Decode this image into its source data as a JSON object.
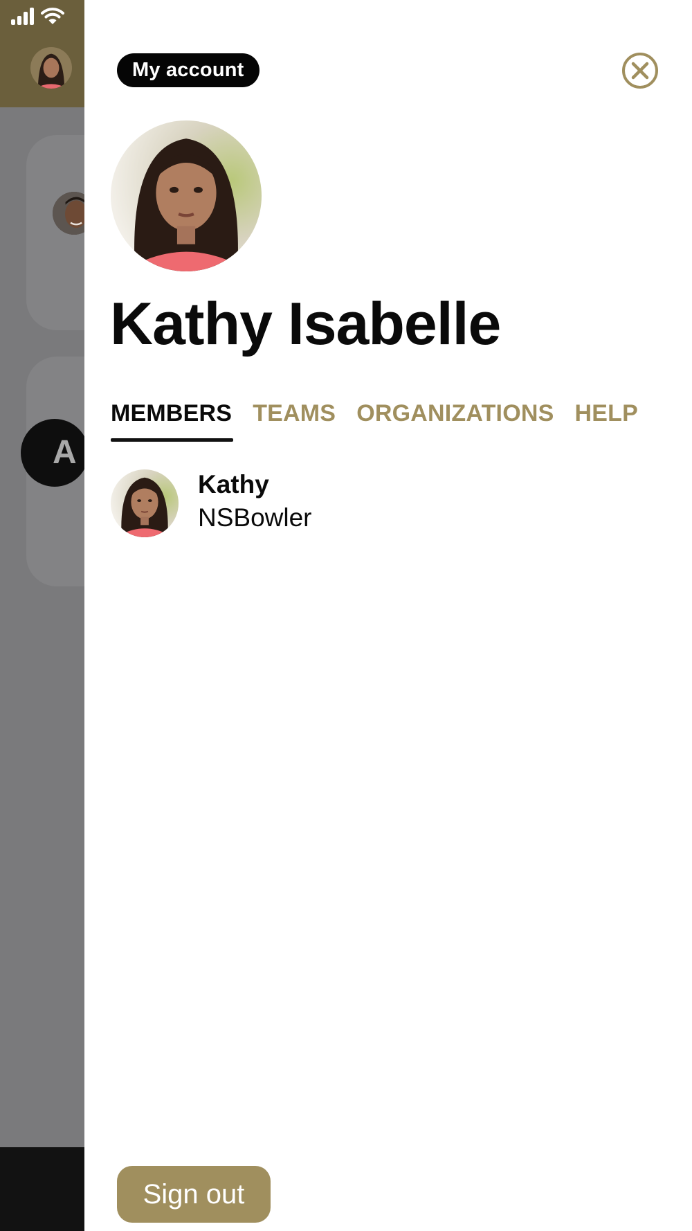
{
  "header": {
    "account_label": "My account"
  },
  "profile": {
    "name": "Kathy Isabelle"
  },
  "tabs": [
    {
      "label": "MEMBERS",
      "active": true
    },
    {
      "label": "TEAMS",
      "active": false
    },
    {
      "label": "ORGANIZATIONS",
      "active": false
    },
    {
      "label": "HELP",
      "active": false
    }
  ],
  "members": [
    {
      "name": "Kathy",
      "username": "NSBowler"
    }
  ],
  "footer": {
    "sign_out_label": "Sign out"
  },
  "background": {
    "avatar_letter": "A"
  },
  "icons": {
    "close": "close-circle-icon",
    "signal": "cellular-signal-icon",
    "wifi": "wifi-icon"
  },
  "colors": {
    "accent": "#a08f5e",
    "header_bg": "#6b5f3c",
    "text": "#0a0a0a",
    "pill_bg": "#050505"
  }
}
